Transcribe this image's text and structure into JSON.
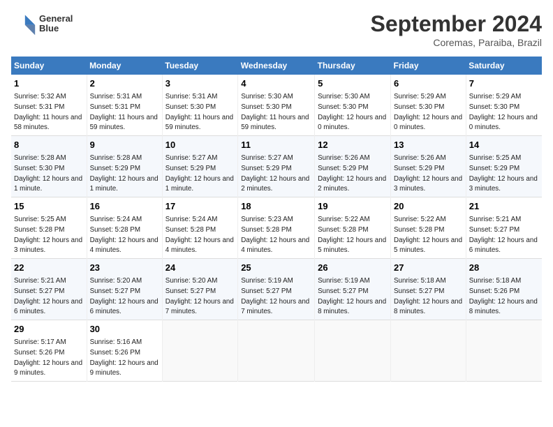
{
  "header": {
    "logo_line1": "General",
    "logo_line2": "Blue",
    "month_title": "September 2024",
    "location": "Coremas, Paraiba, Brazil"
  },
  "days_of_week": [
    "Sunday",
    "Monday",
    "Tuesday",
    "Wednesday",
    "Thursday",
    "Friday",
    "Saturday"
  ],
  "weeks": [
    [
      {
        "day": "1",
        "sunrise": "5:32 AM",
        "sunset": "5:31 PM",
        "daylight": "11 hours and 58 minutes."
      },
      {
        "day": "2",
        "sunrise": "5:31 AM",
        "sunset": "5:31 PM",
        "daylight": "11 hours and 59 minutes."
      },
      {
        "day": "3",
        "sunrise": "5:31 AM",
        "sunset": "5:30 PM",
        "daylight": "11 hours and 59 minutes."
      },
      {
        "day": "4",
        "sunrise": "5:30 AM",
        "sunset": "5:30 PM",
        "daylight": "11 hours and 59 minutes."
      },
      {
        "day": "5",
        "sunrise": "5:30 AM",
        "sunset": "5:30 PM",
        "daylight": "12 hours and 0 minutes."
      },
      {
        "day": "6",
        "sunrise": "5:29 AM",
        "sunset": "5:30 PM",
        "daylight": "12 hours and 0 minutes."
      },
      {
        "day": "7",
        "sunrise": "5:29 AM",
        "sunset": "5:30 PM",
        "daylight": "12 hours and 0 minutes."
      }
    ],
    [
      {
        "day": "8",
        "sunrise": "5:28 AM",
        "sunset": "5:30 PM",
        "daylight": "12 hours and 1 minute."
      },
      {
        "day": "9",
        "sunrise": "5:28 AM",
        "sunset": "5:29 PM",
        "daylight": "12 hours and 1 minute."
      },
      {
        "day": "10",
        "sunrise": "5:27 AM",
        "sunset": "5:29 PM",
        "daylight": "12 hours and 1 minute."
      },
      {
        "day": "11",
        "sunrise": "5:27 AM",
        "sunset": "5:29 PM",
        "daylight": "12 hours and 2 minutes."
      },
      {
        "day": "12",
        "sunrise": "5:26 AM",
        "sunset": "5:29 PM",
        "daylight": "12 hours and 2 minutes."
      },
      {
        "day": "13",
        "sunrise": "5:26 AM",
        "sunset": "5:29 PM",
        "daylight": "12 hours and 3 minutes."
      },
      {
        "day": "14",
        "sunrise": "5:25 AM",
        "sunset": "5:29 PM",
        "daylight": "12 hours and 3 minutes."
      }
    ],
    [
      {
        "day": "15",
        "sunrise": "5:25 AM",
        "sunset": "5:28 PM",
        "daylight": "12 hours and 3 minutes."
      },
      {
        "day": "16",
        "sunrise": "5:24 AM",
        "sunset": "5:28 PM",
        "daylight": "12 hours and 4 minutes."
      },
      {
        "day": "17",
        "sunrise": "5:24 AM",
        "sunset": "5:28 PM",
        "daylight": "12 hours and 4 minutes."
      },
      {
        "day": "18",
        "sunrise": "5:23 AM",
        "sunset": "5:28 PM",
        "daylight": "12 hours and 4 minutes."
      },
      {
        "day": "19",
        "sunrise": "5:22 AM",
        "sunset": "5:28 PM",
        "daylight": "12 hours and 5 minutes."
      },
      {
        "day": "20",
        "sunrise": "5:22 AM",
        "sunset": "5:28 PM",
        "daylight": "12 hours and 5 minutes."
      },
      {
        "day": "21",
        "sunrise": "5:21 AM",
        "sunset": "5:27 PM",
        "daylight": "12 hours and 6 minutes."
      }
    ],
    [
      {
        "day": "22",
        "sunrise": "5:21 AM",
        "sunset": "5:27 PM",
        "daylight": "12 hours and 6 minutes."
      },
      {
        "day": "23",
        "sunrise": "5:20 AM",
        "sunset": "5:27 PM",
        "daylight": "12 hours and 6 minutes."
      },
      {
        "day": "24",
        "sunrise": "5:20 AM",
        "sunset": "5:27 PM",
        "daylight": "12 hours and 7 minutes."
      },
      {
        "day": "25",
        "sunrise": "5:19 AM",
        "sunset": "5:27 PM",
        "daylight": "12 hours and 7 minutes."
      },
      {
        "day": "26",
        "sunrise": "5:19 AM",
        "sunset": "5:27 PM",
        "daylight": "12 hours and 8 minutes."
      },
      {
        "day": "27",
        "sunrise": "5:18 AM",
        "sunset": "5:27 PM",
        "daylight": "12 hours and 8 minutes."
      },
      {
        "day": "28",
        "sunrise": "5:18 AM",
        "sunset": "5:26 PM",
        "daylight": "12 hours and 8 minutes."
      }
    ],
    [
      {
        "day": "29",
        "sunrise": "5:17 AM",
        "sunset": "5:26 PM",
        "daylight": "12 hours and 9 minutes."
      },
      {
        "day": "30",
        "sunrise": "5:16 AM",
        "sunset": "5:26 PM",
        "daylight": "12 hours and 9 minutes."
      },
      null,
      null,
      null,
      null,
      null
    ]
  ]
}
